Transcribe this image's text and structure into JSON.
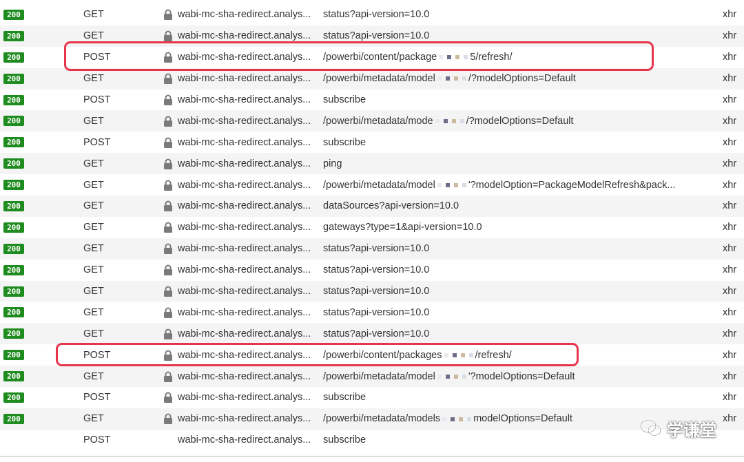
{
  "requests": [
    {
      "status": "200",
      "method": "GET",
      "domain": "wabi-mc-sha-redirect.analys...",
      "path": "status?api-version=10.0",
      "type": "xhr"
    },
    {
      "status": "200",
      "method": "GET",
      "domain": "wabi-mc-sha-redirect.analys...",
      "path": "status?api-version=10.0",
      "type": "xhr"
    },
    {
      "status": "200",
      "method": "POST",
      "domain": "wabi-mc-sha-redirect.analys...",
      "path": "/powerbi/content/package",
      "path_end": "5/refresh/",
      "type": "xhr",
      "redacted": true
    },
    {
      "status": "200",
      "method": "GET",
      "domain": "wabi-mc-sha-redirect.analys...",
      "path": "/powerbi/metadata/model",
      "path_end": "/?modelOptions=Default",
      "type": "xhr",
      "redacted": true
    },
    {
      "status": "200",
      "method": "POST",
      "domain": "wabi-mc-sha-redirect.analys...",
      "path": "subscribe",
      "type": "xhr"
    },
    {
      "status": "200",
      "method": "GET",
      "domain": "wabi-mc-sha-redirect.analys...",
      "path": "/powerbi/metadata/mode",
      "path_end": "/?modelOptions=Default",
      "type": "xhr",
      "redacted": true
    },
    {
      "status": "200",
      "method": "POST",
      "domain": "wabi-mc-sha-redirect.analys...",
      "path": "subscribe",
      "type": "xhr"
    },
    {
      "status": "200",
      "method": "GET",
      "domain": "wabi-mc-sha-redirect.analys...",
      "path": "ping",
      "type": "xhr"
    },
    {
      "status": "200",
      "method": "GET",
      "domain": "wabi-mc-sha-redirect.analys...",
      "path": "/powerbi/metadata/model",
      "path_end": "'?modelOption=PackageModelRefresh&pack...",
      "type": "xhr",
      "redacted": true
    },
    {
      "status": "200",
      "method": "GET",
      "domain": "wabi-mc-sha-redirect.analys...",
      "path": "dataSources?api-version=10.0",
      "type": "xhr"
    },
    {
      "status": "200",
      "method": "GET",
      "domain": "wabi-mc-sha-redirect.analys...",
      "path": "gateways?type=1&api-version=10.0",
      "type": "xhr"
    },
    {
      "status": "200",
      "method": "GET",
      "domain": "wabi-mc-sha-redirect.analys...",
      "path": "status?api-version=10.0",
      "type": "xhr"
    },
    {
      "status": "200",
      "method": "GET",
      "domain": "wabi-mc-sha-redirect.analys...",
      "path": "status?api-version=10.0",
      "type": "xhr"
    },
    {
      "status": "200",
      "method": "GET",
      "domain": "wabi-mc-sha-redirect.analys...",
      "path": "status?api-version=10.0",
      "type": "xhr"
    },
    {
      "status": "200",
      "method": "GET",
      "domain": "wabi-mc-sha-redirect.analys...",
      "path": "status?api-version=10.0",
      "type": "xhr"
    },
    {
      "status": "200",
      "method": "GET",
      "domain": "wabi-mc-sha-redirect.analys...",
      "path": "status?api-version=10.0",
      "type": "xhr"
    },
    {
      "status": "200",
      "method": "POST",
      "domain": "wabi-mc-sha-redirect.analys...",
      "path": "/powerbi/content/packages",
      "path_end": "/refresh/",
      "type": "xhr",
      "redacted": true
    },
    {
      "status": "200",
      "method": "GET",
      "domain": "wabi-mc-sha-redirect.analys...",
      "path": "/powerbi/metadata/model",
      "path_end": "'?modelOptions=Default",
      "type": "xhr",
      "redacted": true
    },
    {
      "status": "200",
      "method": "POST",
      "domain": "wabi-mc-sha-redirect.analys...",
      "path": "subscribe",
      "type": "xhr"
    },
    {
      "status": "200",
      "method": "GET",
      "domain": "wabi-mc-sha-redirect.analys...",
      "path": "/powerbi/metadata/models",
      "path_end": "modelOptions=Default",
      "type": "xhr",
      "redacted": true
    },
    {
      "status": "",
      "method": "POST",
      "domain": "wabi-mc-sha-redirect.analys...",
      "path": "subscribe",
      "type": "",
      "redacted": false
    }
  ],
  "watermark": {
    "text": "学谦堂",
    "icon": "wechat-icon"
  },
  "colors": {
    "status_ok": "#1e8c1e",
    "highlight": "#e8344b",
    "stripe": "#f4f4f4"
  }
}
